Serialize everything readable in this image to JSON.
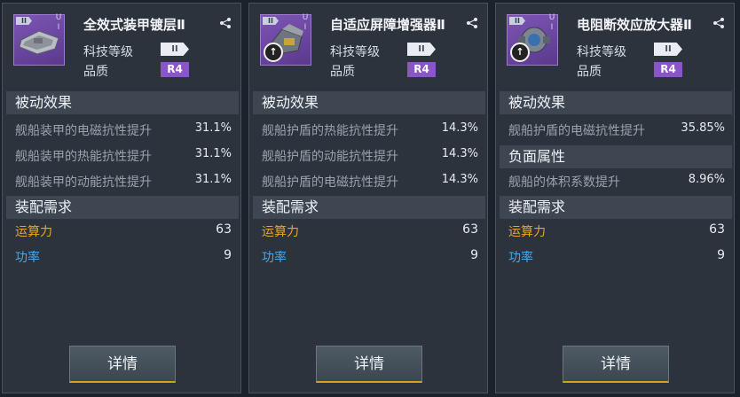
{
  "cards": [
    {
      "tier": "II",
      "ui": [
        "U",
        "I"
      ],
      "title": "全效式装甲镀层Ⅱ",
      "tech_label": "科技等级",
      "tech_level": "II",
      "quality_label": "品质",
      "quality": "R4",
      "passive_header": "被动效果",
      "stats": [
        {
          "label": "舰船装甲的电磁抗性提升",
          "value": "31.1%"
        },
        {
          "label": "舰船装甲的热能抗性提升",
          "value": "31.1%"
        },
        {
          "label": "舰船装甲的动能抗性提升",
          "value": "31.1%"
        }
      ],
      "requirements_header": "装配需求",
      "compute_label": "运算力",
      "compute_value": "63",
      "power_label": "功率",
      "power_value": "9",
      "button": "详情"
    },
    {
      "tier": "II",
      "ui": [
        "U",
        "I"
      ],
      "title": "自适应屏障增强器Ⅱ",
      "tech_label": "科技等级",
      "tech_level": "II",
      "quality_label": "品质",
      "quality": "R4",
      "passive_header": "被动效果",
      "stats": [
        {
          "label": "舰船护盾的热能抗性提升",
          "value": "14.3%"
        },
        {
          "label": "舰船护盾的动能抗性提升",
          "value": "14.3%"
        },
        {
          "label": "舰船护盾的电磁抗性提升",
          "value": "14.3%"
        }
      ],
      "requirements_header": "装配需求",
      "compute_label": "运算力",
      "compute_value": "63",
      "power_label": "功率",
      "power_value": "9",
      "button": "详情"
    },
    {
      "tier": "II",
      "ui": [
        "U",
        "I"
      ],
      "title": "电阻断效应放大器Ⅱ",
      "tech_label": "科技等级",
      "tech_level": "II",
      "quality_label": "品质",
      "quality": "R4",
      "passive_header": "被动效果",
      "stats": [
        {
          "label": "舰船护盾的电磁抗性提升",
          "value": "35.85%"
        }
      ],
      "negative_header": "负面属性",
      "negative_stats": [
        {
          "label": "舰船的体积系数提升",
          "value": "8.96%"
        }
      ],
      "requirements_header": "装配需求",
      "compute_label": "运算力",
      "compute_value": "63",
      "power_label": "功率",
      "power_value": "9",
      "button": "详情"
    }
  ],
  "colors": {
    "compute": "#e6a629",
    "power": "#4aa8e8",
    "quality_badge": "#8a55c6",
    "button_accent": "#d6a21a"
  }
}
